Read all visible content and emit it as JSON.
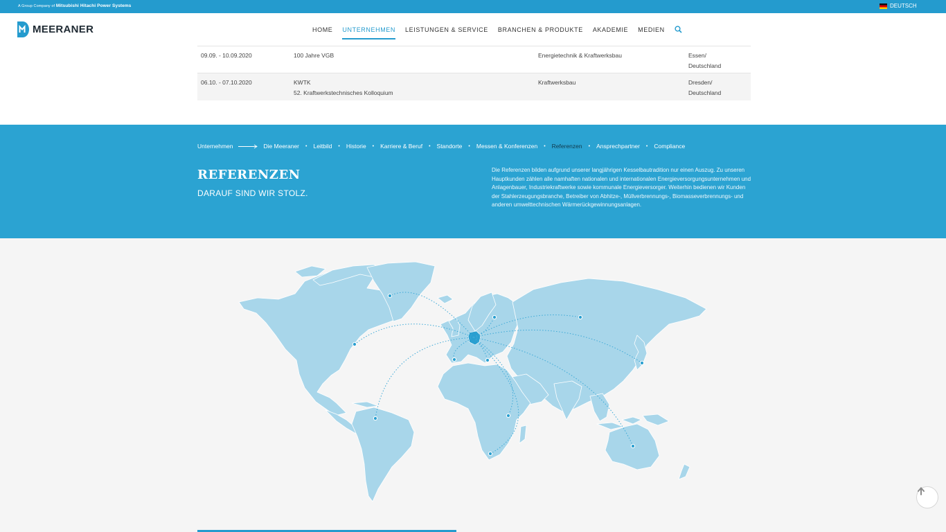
{
  "topbar": {
    "company_prefix": "A Group Company of",
    "company_name": "Mitsubishi Hitachi Power Systems",
    "language": "DEUTSCH"
  },
  "header": {
    "logo_text": "MEERANER",
    "nav": [
      {
        "label": "HOME",
        "active": false
      },
      {
        "label": "UNTERNEHMEN",
        "active": true
      },
      {
        "label": "LEISTUNGEN & SERVICE",
        "active": false
      },
      {
        "label": "BRANCHEN & PRODUKTE",
        "active": false
      },
      {
        "label": "AKADEMIE",
        "active": false
      },
      {
        "label": "MEDIEN",
        "active": false
      }
    ],
    "search_icon": "search-icon"
  },
  "events": [
    {
      "date": "09.09. - 10.09.2020",
      "name_1": "100 Jahre VGB",
      "name_2": "",
      "category": "Energietechnik & Kraftwerksbau",
      "location_1": "Essen/",
      "location_2": "Deutschland"
    },
    {
      "date": "06.10. - 07.10.2020",
      "name_1": "KWTK",
      "name_2": "52. Kraftwerkstechnisches Kolloquium",
      "category": "Kraftwerksbau",
      "location_1": "Dresden/",
      "location_2": "Deutschland"
    }
  ],
  "banner": {
    "breadcrumb_root": "Unternehmen",
    "breadcrumb_items": [
      "Die Meeraner",
      "Leitbild",
      "Historie",
      "Karriere & Beruf",
      "Standorte",
      "Messen & Konferenzen",
      "Referenzen",
      "Ansprechpartner",
      "Compliance"
    ],
    "current": "Referenzen",
    "title": "REFERENZEN",
    "subtitle": "DARAUF SIND WIR STOLZ.",
    "intro": "Die Referenzen bilden aufgrund unserer langjährigen Kesselbautradition nur einen Auszug. Zu unseren Hauptkunden zählen alle namhaften nationalen und internationalen Energieversorgungsunternehmen und Anlagenbauer, Industriekraftwerke sowie kommunale Energieversorger. Weiterhin bedienen wir Kunden der Stahlerzeugungsbranche, Betreiber von Abhitze-, Müllverbrennungs-, Biomasseverbrennungs- und anderen umwelttechnischen Wärmerückgewinnungsanlagen."
  },
  "colors": {
    "accent": "#249bce",
    "banner": "#2ba3d2",
    "land": "#a8d6ea",
    "germany": "#2a9fd0",
    "route": "#3ba8d6"
  },
  "map": {
    "icon": "world-map",
    "hub": "Deutschland"
  },
  "scroll_top_icon": "arrow-up-icon"
}
